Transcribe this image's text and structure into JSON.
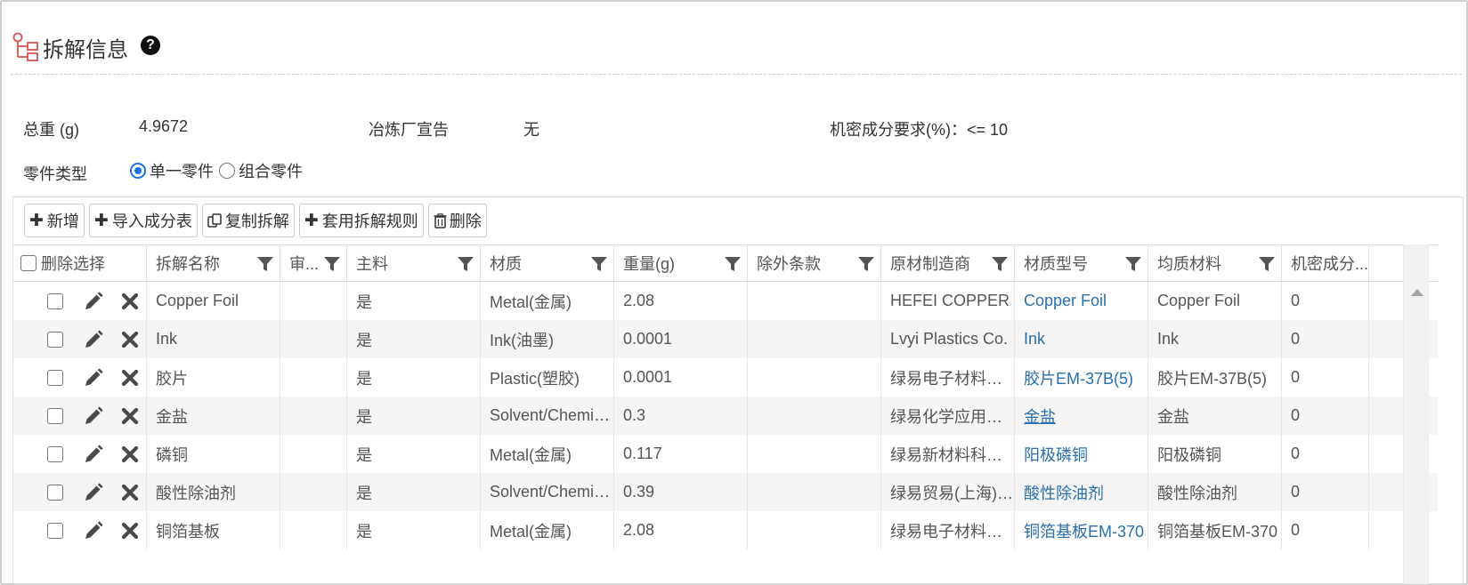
{
  "header": {
    "title": "拆解信息",
    "help_icon": "?"
  },
  "info": {
    "total_weight_label": "总重 (g)",
    "total_weight_value": "4.9672",
    "smelter_label": "冶炼厂宣告",
    "smelter_value": "无",
    "secret_label": "机密成分要求(%)：<= 10",
    "part_type_label": "零件类型",
    "part_type_options": [
      "单一零件",
      "组合零件"
    ],
    "part_type_selected": "单一零件"
  },
  "toolbar": {
    "add": "新增",
    "import": "导入成分表",
    "copy": "复制拆解",
    "apply_rule": "套用拆解规则",
    "delete": "删除"
  },
  "table": {
    "headers": [
      "删除选择",
      "拆解名称",
      "审...",
      "主料",
      "材质",
      "重量(g)",
      "除外条款",
      "原材制造商",
      "材质型号",
      "均质材料",
      "机密成分..."
    ],
    "rows": [
      {
        "name": "Copper Foil",
        "review": "",
        "main": "是",
        "material": "Metal(金属)",
        "weight": "2.08",
        "exclusion": "",
        "maker": "HEFEI COPPER",
        "model": "Copper Foil",
        "homogeneous": "Copper Foil",
        "secret": "0"
      },
      {
        "name": "Ink",
        "review": "",
        "main": "是",
        "material": "Ink(油墨)",
        "weight": "0.0001",
        "exclusion": "",
        "maker": "Lvyi Plastics Co.",
        "model": "Ink",
        "homogeneous": "Ink",
        "secret": "0"
      },
      {
        "name": "胶片",
        "review": "",
        "main": "是",
        "material": "Plastic(塑胶)",
        "weight": "0.0001",
        "exclusion": "",
        "maker": "绿易电子材料有限公司",
        "model": "胶片EM-37B(5)",
        "homogeneous": "胶片EM-37B(5)",
        "secret": "0"
      },
      {
        "name": "金盐",
        "review": "",
        "main": "是",
        "material": "Solvent/Chemical",
        "weight": "0.3",
        "exclusion": "",
        "maker": "绿易化学应用有限公司",
        "model": "金盐",
        "homogeneous": "金盐",
        "secret": "0"
      },
      {
        "name": "磷铜",
        "review": "",
        "main": "是",
        "material": "Metal(金属)",
        "weight": "0.117",
        "exclusion": "",
        "maker": "绿易新材料科技有限公司",
        "model": "阳极磷铜",
        "homogeneous": "阳极磷铜",
        "secret": "0"
      },
      {
        "name": "酸性除油剂",
        "review": "",
        "main": "是",
        "material": "Solvent/Chemical",
        "weight": "0.39",
        "exclusion": "",
        "maker": "绿易贸易(上海)有限公司",
        "model": "酸性除油剂",
        "homogeneous": "酸性除油剂",
        "secret": "0"
      },
      {
        "name": "铜箔基板",
        "review": "",
        "main": "是",
        "material": "Metal(金属)",
        "weight": "2.08",
        "exclusion": "",
        "maker": "绿易电子材料有限公司",
        "model": "铜箔基板EM-370",
        "homogeneous": "铜箔基板EM-370",
        "secret": "0"
      }
    ]
  }
}
